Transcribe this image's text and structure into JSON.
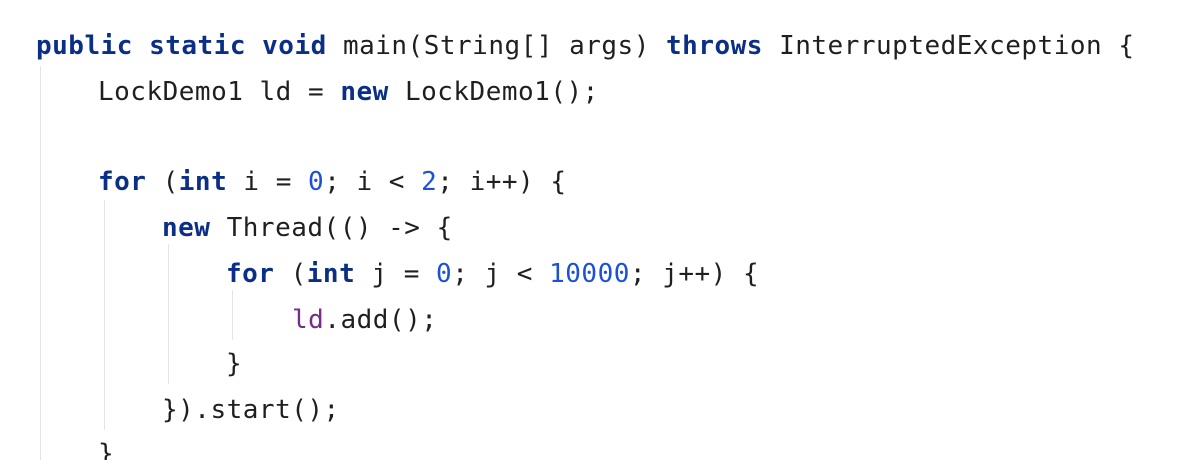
{
  "code": {
    "line1": {
      "kw_public": "public",
      "kw_static": "static",
      "kw_void": "void",
      "text_main": "main(String[] args)",
      "kw_throws": "throws",
      "text_exception": "InterruptedException {"
    },
    "line2": {
      "text_decl": "LockDemo1 ld =",
      "kw_new": "new",
      "text_ctor": "LockDemo1();"
    },
    "line4": {
      "kw_for": "for",
      "text_open": "(",
      "kw_int": "int",
      "text_init": "i =",
      "num_init": "0",
      "text_cond": "; i <",
      "num_bound": "2",
      "text_rest": "; i++) {"
    },
    "line5": {
      "kw_new": "new",
      "text_thread": "Thread(() -> {"
    },
    "line6": {
      "kw_for": "for",
      "text_open": "(",
      "kw_int": "int",
      "text_init": "j =",
      "num_init": "0",
      "text_cond": "; j <",
      "num_bound": "10000",
      "text_rest": "; j++) {"
    },
    "line7": {
      "fld_ld": "ld",
      "text_call": ".add();"
    },
    "line8": {
      "text": "}"
    },
    "line9": {
      "text": "}).start();"
    },
    "line10": {
      "text": "}"
    }
  }
}
